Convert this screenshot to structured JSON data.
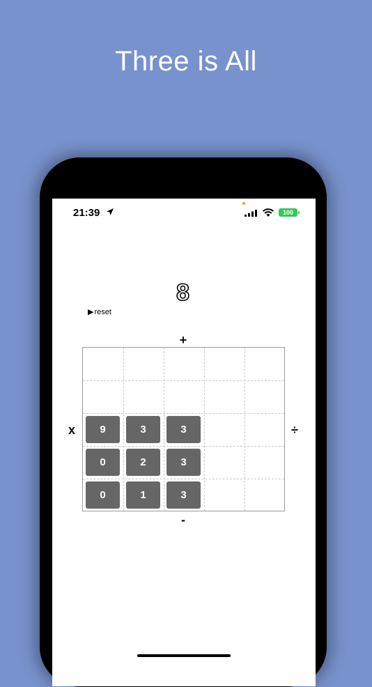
{
  "headline": "Three is All",
  "status_bar": {
    "time": "21:39",
    "battery": "100",
    "icons": [
      "location-arrow-icon",
      "cellular-signal-icon",
      "wifi-icon",
      "battery-icon"
    ]
  },
  "game": {
    "score": "8",
    "reset_label": "reset",
    "ops": {
      "top": "+",
      "left": "x",
      "right": "÷",
      "bottom": "-"
    },
    "tiles": [
      [
        "9",
        "3",
        "3"
      ],
      [
        "0",
        "2",
        "3"
      ],
      [
        "0",
        "1",
        "3"
      ]
    ]
  },
  "colors": {
    "background": "#7792cd",
    "tile": "#666666",
    "battery": "#33c759"
  }
}
